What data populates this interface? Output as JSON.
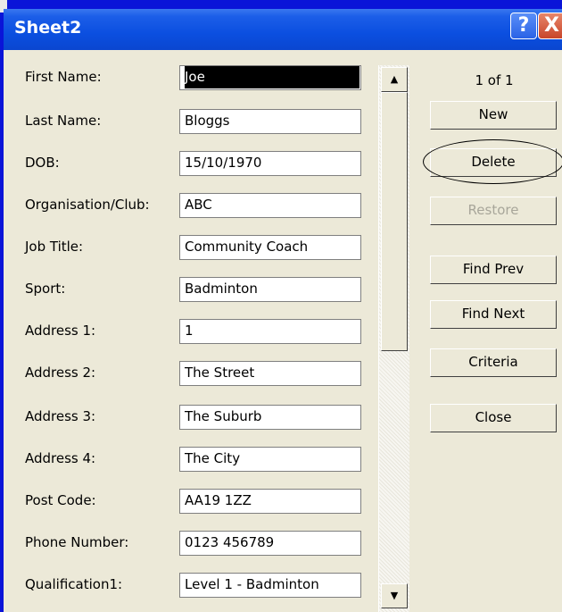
{
  "window": {
    "title": "Sheet2",
    "help_glyph": "?",
    "close_glyph": "X"
  },
  "form": {
    "fields": [
      {
        "label": "First Name:",
        "value": "Joe"
      },
      {
        "label": "Last Name:",
        "value": "Bloggs"
      },
      {
        "label": "DOB:",
        "value": "15/10/1970"
      },
      {
        "label": "Organisation/Club:",
        "value": "ABC"
      },
      {
        "label": "Job Title:",
        "value": "Community Coach"
      },
      {
        "label": "Sport:",
        "value": "Badminton"
      },
      {
        "label": "Address 1:",
        "value": "1"
      },
      {
        "label": "Address 2:",
        "value": "The Street"
      },
      {
        "label": "Address 3:",
        "value": "The Suburb"
      },
      {
        "label": "Address 4:",
        "value": "The City"
      },
      {
        "label": "Post Code:",
        "value": "AA19 1ZZ"
      },
      {
        "label": "Phone Number:",
        "value": "0123 456789"
      },
      {
        "label": "Qualification1:",
        "value": "Level 1 - Badminton"
      }
    ]
  },
  "record_counter": "1 of 1",
  "buttons": {
    "new": "New",
    "delete": "Delete",
    "restore": "Restore",
    "find_prev": "Find Prev",
    "find_next": "Find Next",
    "criteria": "Criteria",
    "close": "Close"
  },
  "scrollbar": {
    "up_glyph": "▲",
    "down_glyph": "▼"
  }
}
